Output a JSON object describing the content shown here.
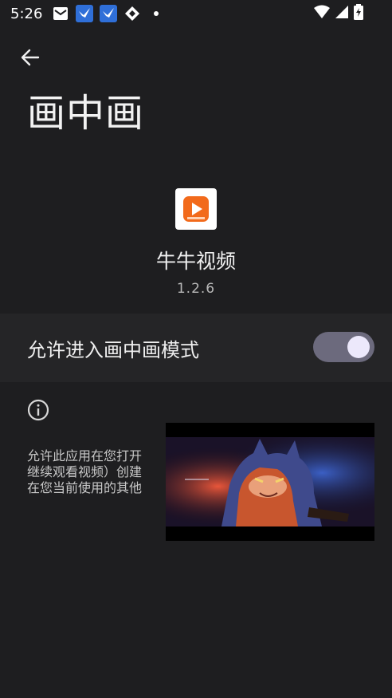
{
  "status_bar": {
    "time": "5:26",
    "notification_icons": [
      "mail-icon",
      "bird-app-icon",
      "bird-app-icon",
      "diamond-app-icon",
      "dot-icon"
    ],
    "system_icons": [
      "wifi-icon",
      "signal-icon",
      "battery-charging-icon"
    ]
  },
  "header": {
    "title": "画中画"
  },
  "app": {
    "name": "牛牛视频",
    "version": "1.2.6"
  },
  "setting": {
    "label": "允许进入画中画模式",
    "enabled": true,
    "accent_color": "#ece8fb",
    "track_color": "#6c6a7d"
  },
  "description": {
    "lines": [
      "允许此应用在您打开",
      "继续观看视频）创建",
      "在您当前使用的其他"
    ]
  },
  "pip": {
    "content": "animated-wolf-character-video"
  }
}
